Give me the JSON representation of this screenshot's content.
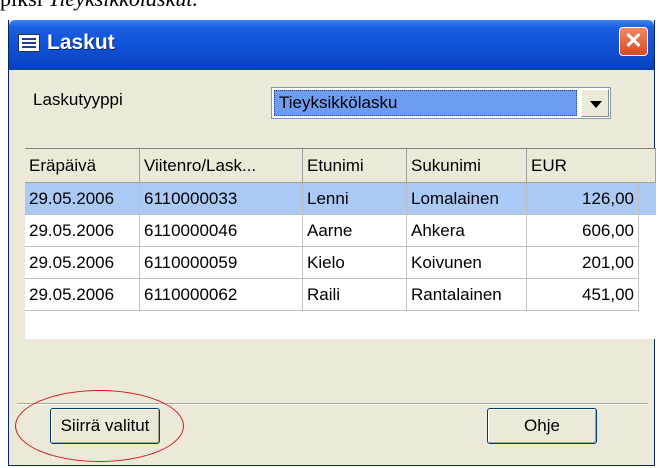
{
  "doc": {
    "text_plain": "piksi ",
    "text_italic": "Tieyksikkölaskut."
  },
  "window": {
    "title": "Laskut",
    "title_icon": "window-menu-icon",
    "close_icon": "close-icon",
    "close_glyph": "✕"
  },
  "filter": {
    "label": "Laskutyyppi",
    "selected": "Tieyksikkölasku",
    "dropdown_icon": "chevron-down-icon"
  },
  "table": {
    "columns": [
      "Eräpäivä",
      "Viitenro/Lask...",
      "Etunimi",
      "Sukunimi",
      "EUR"
    ],
    "rows": [
      {
        "date": "29.05.2006",
        "ref": "6110000033",
        "first": "Lenni",
        "last": "Lomalainen",
        "eur": "126,00",
        "selected": true
      },
      {
        "date": "29.05.2006",
        "ref": "6110000046",
        "first": "Aarne",
        "last": "Ahkera",
        "eur": "606,00",
        "selected": false
      },
      {
        "date": "29.05.2006",
        "ref": "6110000059",
        "first": "Kielo",
        "last": "Koivunen",
        "eur": "201,00",
        "selected": false
      },
      {
        "date": "29.05.2006",
        "ref": "6110000062",
        "first": "Raili",
        "last": "Rantalainen",
        "eur": "451,00",
        "selected": false
      }
    ]
  },
  "buttons": {
    "move_selected": "Siirrä valitut",
    "help": "Ohje"
  },
  "colors": {
    "title_bar": "#0f52d8",
    "selected_row": "#aac9f5",
    "annotation_ellipse": "#d01818"
  }
}
